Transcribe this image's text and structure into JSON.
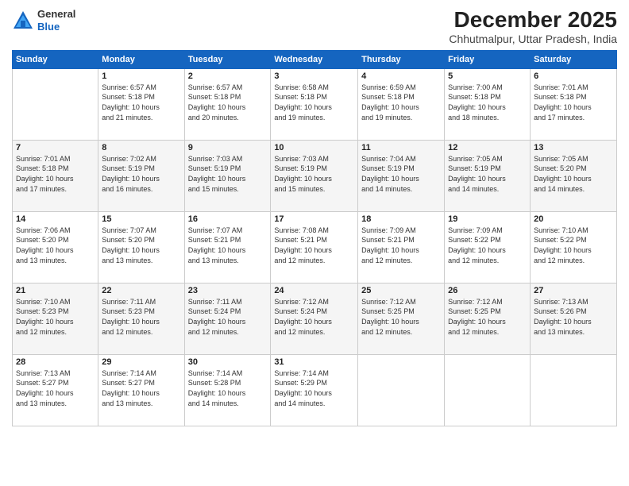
{
  "header": {
    "logo": {
      "general": "General",
      "blue": "Blue"
    },
    "title": "December 2025",
    "location": "Chhutmalpur, Uttar Pradesh, India"
  },
  "weekdays": [
    "Sunday",
    "Monday",
    "Tuesday",
    "Wednesday",
    "Thursday",
    "Friday",
    "Saturday"
  ],
  "weeks": [
    [
      {
        "day": "",
        "info": ""
      },
      {
        "day": "1",
        "info": "Sunrise: 6:57 AM\nSunset: 5:18 PM\nDaylight: 10 hours\nand 21 minutes."
      },
      {
        "day": "2",
        "info": "Sunrise: 6:57 AM\nSunset: 5:18 PM\nDaylight: 10 hours\nand 20 minutes."
      },
      {
        "day": "3",
        "info": "Sunrise: 6:58 AM\nSunset: 5:18 PM\nDaylight: 10 hours\nand 19 minutes."
      },
      {
        "day": "4",
        "info": "Sunrise: 6:59 AM\nSunset: 5:18 PM\nDaylight: 10 hours\nand 19 minutes."
      },
      {
        "day": "5",
        "info": "Sunrise: 7:00 AM\nSunset: 5:18 PM\nDaylight: 10 hours\nand 18 minutes."
      },
      {
        "day": "6",
        "info": "Sunrise: 7:01 AM\nSunset: 5:18 PM\nDaylight: 10 hours\nand 17 minutes."
      }
    ],
    [
      {
        "day": "7",
        "info": "Sunrise: 7:01 AM\nSunset: 5:18 PM\nDaylight: 10 hours\nand 17 minutes."
      },
      {
        "day": "8",
        "info": "Sunrise: 7:02 AM\nSunset: 5:19 PM\nDaylight: 10 hours\nand 16 minutes."
      },
      {
        "day": "9",
        "info": "Sunrise: 7:03 AM\nSunset: 5:19 PM\nDaylight: 10 hours\nand 15 minutes."
      },
      {
        "day": "10",
        "info": "Sunrise: 7:03 AM\nSunset: 5:19 PM\nDaylight: 10 hours\nand 15 minutes."
      },
      {
        "day": "11",
        "info": "Sunrise: 7:04 AM\nSunset: 5:19 PM\nDaylight: 10 hours\nand 14 minutes."
      },
      {
        "day": "12",
        "info": "Sunrise: 7:05 AM\nSunset: 5:19 PM\nDaylight: 10 hours\nand 14 minutes."
      },
      {
        "day": "13",
        "info": "Sunrise: 7:05 AM\nSunset: 5:20 PM\nDaylight: 10 hours\nand 14 minutes."
      }
    ],
    [
      {
        "day": "14",
        "info": "Sunrise: 7:06 AM\nSunset: 5:20 PM\nDaylight: 10 hours\nand 13 minutes."
      },
      {
        "day": "15",
        "info": "Sunrise: 7:07 AM\nSunset: 5:20 PM\nDaylight: 10 hours\nand 13 minutes."
      },
      {
        "day": "16",
        "info": "Sunrise: 7:07 AM\nSunset: 5:21 PM\nDaylight: 10 hours\nand 13 minutes."
      },
      {
        "day": "17",
        "info": "Sunrise: 7:08 AM\nSunset: 5:21 PM\nDaylight: 10 hours\nand 12 minutes."
      },
      {
        "day": "18",
        "info": "Sunrise: 7:09 AM\nSunset: 5:21 PM\nDaylight: 10 hours\nand 12 minutes."
      },
      {
        "day": "19",
        "info": "Sunrise: 7:09 AM\nSunset: 5:22 PM\nDaylight: 10 hours\nand 12 minutes."
      },
      {
        "day": "20",
        "info": "Sunrise: 7:10 AM\nSunset: 5:22 PM\nDaylight: 10 hours\nand 12 minutes."
      }
    ],
    [
      {
        "day": "21",
        "info": "Sunrise: 7:10 AM\nSunset: 5:23 PM\nDaylight: 10 hours\nand 12 minutes."
      },
      {
        "day": "22",
        "info": "Sunrise: 7:11 AM\nSunset: 5:23 PM\nDaylight: 10 hours\nand 12 minutes."
      },
      {
        "day": "23",
        "info": "Sunrise: 7:11 AM\nSunset: 5:24 PM\nDaylight: 10 hours\nand 12 minutes."
      },
      {
        "day": "24",
        "info": "Sunrise: 7:12 AM\nSunset: 5:24 PM\nDaylight: 10 hours\nand 12 minutes."
      },
      {
        "day": "25",
        "info": "Sunrise: 7:12 AM\nSunset: 5:25 PM\nDaylight: 10 hours\nand 12 minutes."
      },
      {
        "day": "26",
        "info": "Sunrise: 7:12 AM\nSunset: 5:25 PM\nDaylight: 10 hours\nand 12 minutes."
      },
      {
        "day": "27",
        "info": "Sunrise: 7:13 AM\nSunset: 5:26 PM\nDaylight: 10 hours\nand 13 minutes."
      }
    ],
    [
      {
        "day": "28",
        "info": "Sunrise: 7:13 AM\nSunset: 5:27 PM\nDaylight: 10 hours\nand 13 minutes."
      },
      {
        "day": "29",
        "info": "Sunrise: 7:14 AM\nSunset: 5:27 PM\nDaylight: 10 hours\nand 13 minutes."
      },
      {
        "day": "30",
        "info": "Sunrise: 7:14 AM\nSunset: 5:28 PM\nDaylight: 10 hours\nand 14 minutes."
      },
      {
        "day": "31",
        "info": "Sunrise: 7:14 AM\nSunset: 5:29 PM\nDaylight: 10 hours\nand 14 minutes."
      },
      {
        "day": "",
        "info": ""
      },
      {
        "day": "",
        "info": ""
      },
      {
        "day": "",
        "info": ""
      }
    ]
  ]
}
